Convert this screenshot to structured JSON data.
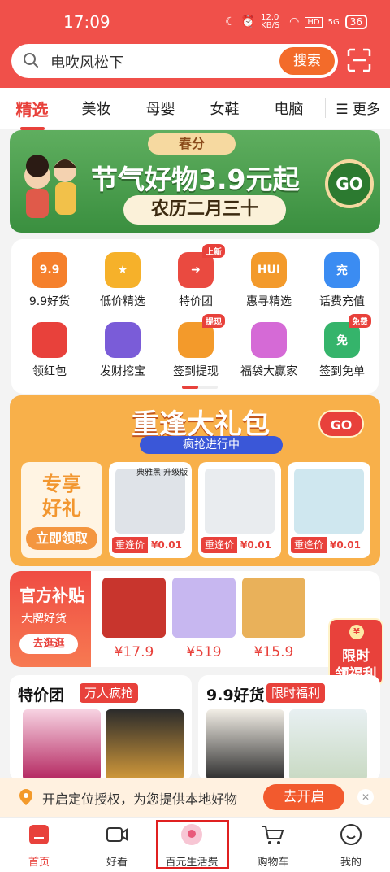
{
  "status": {
    "time": "17:09",
    "net_speed": "12.0 KB/S",
    "hd": "HD",
    "signal": "5G",
    "battery": "36"
  },
  "search": {
    "text": "电吹风松下",
    "button": "搜索"
  },
  "categories": [
    "精选",
    "美妆",
    "母婴",
    "女鞋",
    "电脑"
  ],
  "more_label": "更多",
  "banner": {
    "tag": "春分",
    "title": "节气好物3.9元起",
    "subtitle": "农历二月三十",
    "go": "GO"
  },
  "grid": [
    {
      "label": "9.9好货",
      "icon": "9.9",
      "color": "#f5802c",
      "badge": ""
    },
    {
      "label": "低价精选",
      "icon": "★",
      "color": "#f6b12a",
      "badge": ""
    },
    {
      "label": "特价团",
      "icon": "➜",
      "color": "#ea4a40",
      "badge": "上新"
    },
    {
      "label": "惠寻精选",
      "icon": "HUI",
      "color": "#f39a2b",
      "badge": ""
    },
    {
      "label": "话费充值",
      "icon": "充",
      "color": "#3b8cf2",
      "badge": ""
    },
    {
      "label": "领红包",
      "icon": "",
      "color": "#e8413b",
      "badge": ""
    },
    {
      "label": "发财挖宝",
      "icon": "",
      "color": "#7a5cd8",
      "badge": ""
    },
    {
      "label": "签到提现",
      "icon": "",
      "color": "#f39a2b",
      "badge": "提现"
    },
    {
      "label": "福袋大赢家",
      "icon": "",
      "color": "#d56ad6",
      "badge": ""
    },
    {
      "label": "签到免单",
      "icon": "免",
      "color": "#35b46b",
      "badge": "免费"
    }
  ],
  "promo": {
    "title": "重逢大礼包",
    "subtitle": "疯抢进行中",
    "go": "GO",
    "left_title_1": "专享",
    "left_title_2": "好礼",
    "left_cta": "立即领取",
    "items": [
      {
        "tag": "典雅黑 升级版",
        "price_label": "重逢价",
        "price": "¥0.01",
        "color": "#dfe3e8"
      },
      {
        "tag": "",
        "price_label": "重逢价",
        "price": "¥0.01",
        "color": "#e9ecef"
      },
      {
        "tag": "",
        "price_label": "重逢价",
        "price": "¥0.01",
        "color": "#cfe7ef"
      }
    ]
  },
  "official": {
    "title": "官方补贴",
    "subtitle": "大牌好货",
    "button": "去逛逛",
    "items": [
      {
        "price": "¥17.9",
        "color": "#c8352d"
      },
      {
        "price": "¥519",
        "color": "#c7b7f0"
      },
      {
        "price": "¥15.9",
        "color": "#e9b15a"
      }
    ]
  },
  "limit_badge": {
    "line1": "限时",
    "line2": "领福利"
  },
  "deals": [
    {
      "title": "特价团",
      "tag": "万人疯抢"
    },
    {
      "title": "9.9好货",
      "tag": "限时福利"
    }
  ],
  "location_bar": {
    "text": "开启定位授权，为您提供本地好物",
    "button": "去开启"
  },
  "tabs": [
    "首页",
    "好看",
    "百元生活费",
    "购物车",
    "我的"
  ]
}
